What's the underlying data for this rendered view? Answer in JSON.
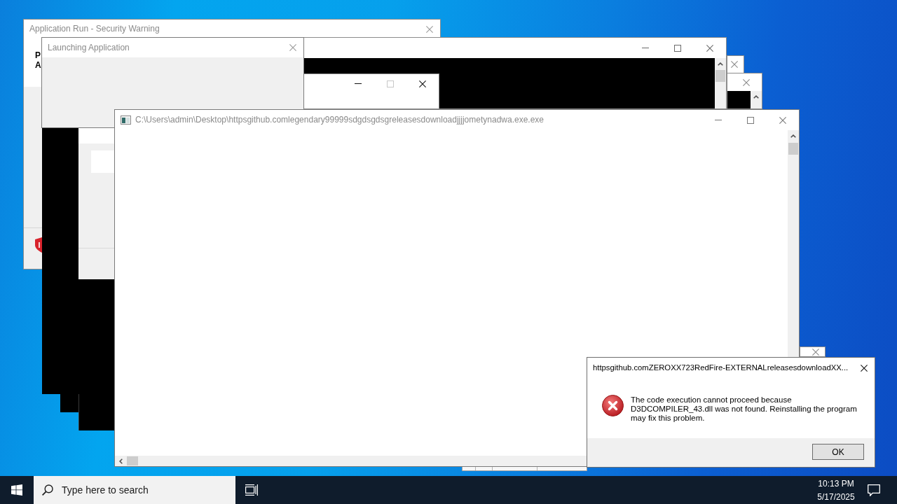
{
  "desktop": {
    "windows": [
      {
        "kind": "stub"
      },
      {
        "kind": "tool"
      },
      {
        "kind": "stub"
      },
      {
        "kind": "edge"
      },
      {
        "kind": "security",
        "title": "Application Run - Security Warning",
        "lines": [
          "P",
          "A"
        ]
      },
      {
        "kind": "console",
        "maximize_disabled": false
      },
      {
        "kind": "blank",
        "maximize_disabled": true
      },
      {
        "kind": "launcher",
        "title": "Launching Application"
      },
      {
        "kind": "backdrop"
      },
      {
        "kind": "backdrop"
      },
      {
        "kind": "backdrop"
      },
      {
        "kind": "panel"
      },
      {
        "kind": "viewer",
        "title": "C:\\Users\\admin\\Desktop\\httpsgithub.comlegendary99999sdgdsgdsgreleasesdownloadjjjjometynadwa.exe.exe",
        "maximize_disabled": false
      },
      {
        "kind": "error",
        "title": "httpsgithub.comZEROXX723RedFire-EXTERNALreleasesdownloadXX...",
        "message": "The code execution cannot proceed because D3DCOMPILER_43.dll was not found. Reinstalling the program may fix this problem.",
        "buttons": [
          {
            "label": "OK"
          }
        ]
      }
    ]
  },
  "taskbar": {
    "search": {
      "placeholder": "Type here to search"
    },
    "clock": {
      "time": "10:13 PM",
      "date": "5/17/2025"
    }
  }
}
